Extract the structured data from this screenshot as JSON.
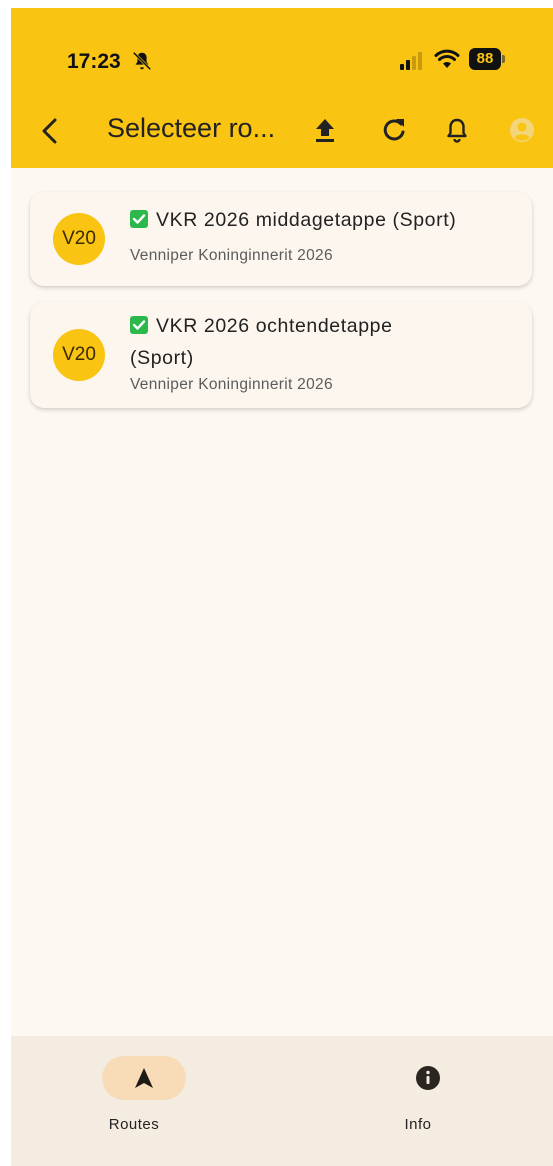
{
  "status_bar": {
    "time": "17:23",
    "battery": "88",
    "icons": [
      "bell-off-icon",
      "cellular-signal-icon",
      "wifi-icon",
      "battery-icon"
    ]
  },
  "toolbar": {
    "title": "Selecteer ro...",
    "icons": [
      "back-chevron-icon",
      "upload-icon",
      "refresh-icon",
      "bell-icon",
      "account-icon"
    ]
  },
  "routes": [
    {
      "badge": "V20",
      "title": "VKR 2026 middagetappe (Sport)",
      "subtitle": "Venniper Koninginnerit 2026"
    },
    {
      "badge": "V20",
      "title_line1": "VKR 2026 ochtendetappe",
      "title_line2": "(Sport)",
      "subtitle": "Venniper Koninginnerit 2026"
    }
  ],
  "bottom_nav": {
    "items": [
      {
        "label": "Routes",
        "icon": "navigation-arrow-icon",
        "active": true
      },
      {
        "label": "Info",
        "icon": "info-icon",
        "active": false
      }
    ]
  },
  "colors": {
    "accent": "#fac412",
    "background": "#fdf8f1",
    "nav_background": "#f4ece0",
    "active_pill": "#f8dcb8",
    "check_green": "#2db84b"
  }
}
